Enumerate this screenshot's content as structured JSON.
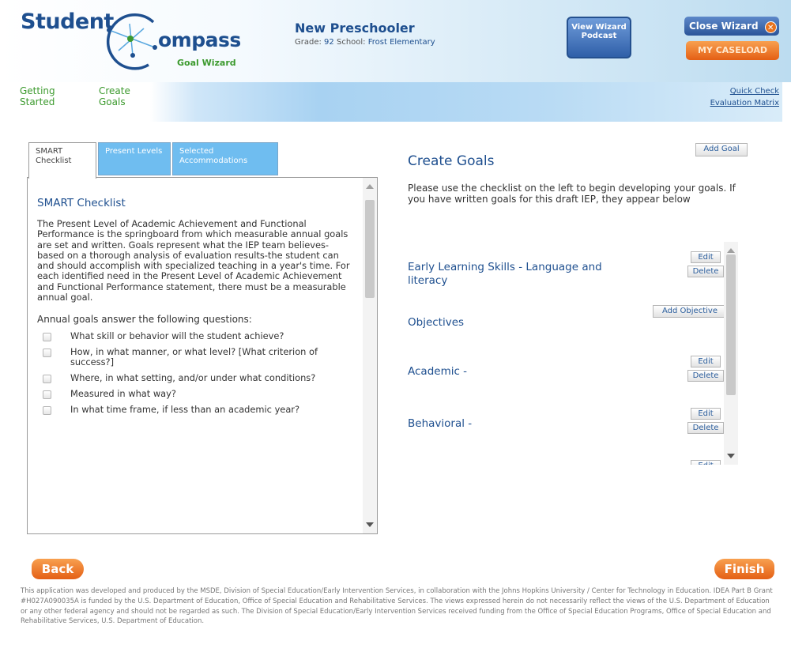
{
  "header": {
    "logo_student": "Student",
    "logo_ompass": "ompass",
    "logo_subtitle": "Goal Wizard",
    "student_name": "New Preschooler",
    "grade_label": "Grade:",
    "grade_value": "92",
    "school_label": "School:",
    "school_value": "Frost Elementary",
    "podcast_label": "View Wizard Podcast",
    "close_wizard_label": "Close Wizard",
    "my_caseload_label": "MY CASELOAD"
  },
  "nav": {
    "steps": [
      "Getting Started",
      "Create Goals"
    ],
    "quick_check": "Quick Check",
    "evaluation_matrix": "Evaluation Matrix"
  },
  "left_panel": {
    "tabs": [
      "SMART Checklist",
      "Present Levels",
      "Selected Accommodations"
    ],
    "title": "SMART Checklist",
    "body": "The Present Level of Academic Achievement and Functional Performance is the springboard from which measurable annual goals are set and written. Goals represent what the IEP team believes-based on a thorough analysis of evaluation results-the student can and should accomplish with specialized teaching in a year's time. For each identified need in the Present Level of Academic Achievement and Functional Performance statement, there must be a measurable annual goal.",
    "questions_intro": "Annual goals answer the following questions:",
    "questions": [
      "What skill or behavior will the student achieve?",
      "How, in what manner, or what level? [What criterion of success?]",
      "Where, in what setting, and/or under what conditions?",
      "Measured in what way?",
      "In what time frame, if less than an academic year?"
    ]
  },
  "right_panel": {
    "title": "Create Goals",
    "add_goal": "Add Goal",
    "intro": "Please use the checklist on the left to begin developing your goals. If you have written goals for this draft IEP, they appear below",
    "goals": [
      {
        "title": "Early Learning Skills - Language and literacy"
      },
      {
        "title": "Objectives"
      },
      {
        "title": "Academic -"
      },
      {
        "title": "Behavioral -"
      }
    ],
    "edit": "Edit",
    "delete": "Delete",
    "add_objective": "Add Objective"
  },
  "buttons": {
    "back": "Back",
    "finish": "Finish"
  },
  "footer": "This application was developed and produced by the MSDE, Division of Special Education/Early Intervention Services, in collaboration with the Johns Hopkins University / Center for Technology in Education. IDEA Part B Grant #H027A090035A is funded by the U.S. Department of Education, Office of Special Education and Rehabilitative Services. The views expressed herein do not necessarily reflect the views of the U.S. Department of Education or any other federal agency and should not be regarded as such. The Division of Special Education/Early Intervention Services received funding from the Office of Special Education Programs, Office of Special Education and Rehabilitative Services, U.S. Department of Education.",
  "colors": {
    "brand_blue": "#1e4f8f",
    "brand_green": "#3c9a2e",
    "orange": "#e45f14",
    "tab_blue": "#6fbdf0"
  }
}
